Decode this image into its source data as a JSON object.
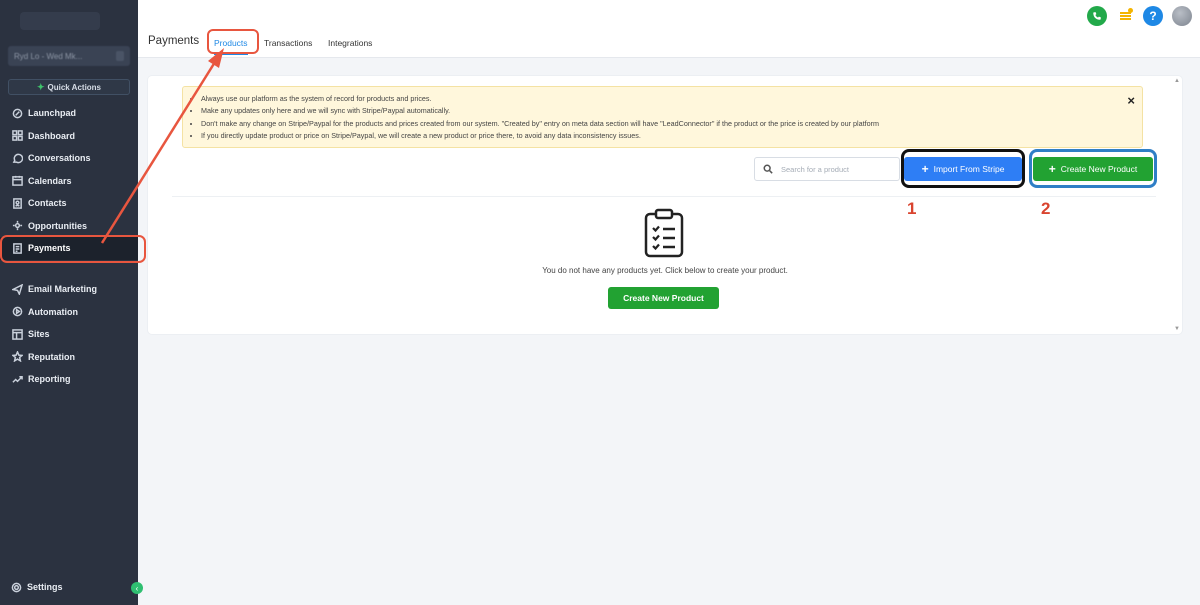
{
  "sidebar": {
    "location_text": "Ryd Lo - Wed Mk...",
    "quick_actions_label": "Quick Actions",
    "items": [
      {
        "label": "Launchpad",
        "icon": "rocket-icon"
      },
      {
        "label": "Dashboard",
        "icon": "dashboard-icon"
      },
      {
        "label": "Conversations",
        "icon": "chat-icon"
      },
      {
        "label": "Calendars",
        "icon": "calendar-icon"
      },
      {
        "label": "Contacts",
        "icon": "contacts-icon"
      },
      {
        "label": "Opportunities",
        "icon": "opportunities-icon"
      },
      {
        "label": "Payments",
        "icon": "payments-icon",
        "active": true
      }
    ],
    "items2": [
      {
        "label": "Email Marketing",
        "icon": "send-icon"
      },
      {
        "label": "Automation",
        "icon": "automation-icon"
      },
      {
        "label": "Sites",
        "icon": "sites-icon"
      },
      {
        "label": "Reputation",
        "icon": "star-icon"
      },
      {
        "label": "Reporting",
        "icon": "chart-icon"
      }
    ],
    "settings_label": "Settings"
  },
  "header": {
    "title": "Payments",
    "tabs": [
      {
        "label": "Products",
        "active": true
      },
      {
        "label": "Transactions"
      },
      {
        "label": "Integrations"
      }
    ]
  },
  "notice": {
    "lines": [
      "Always use our platform as the system of record for products and prices.",
      "Make any updates only here and we will sync with Stripe/Paypal automatically.",
      "Don't make any change on Stripe/Paypal for the products and prices created from our system. \"Created by\" entry on meta data section will have \"LeadConnector\" if the product or the price is created by our platform",
      "If you directly update product or price on Stripe/Paypal, we will create a new product or price there, to avoid any data inconsistency issues."
    ],
    "close_symbol": "×"
  },
  "toolbar": {
    "search_placeholder": "Search for a product",
    "import_label": "Import From Stripe",
    "create_label": "Create New Product"
  },
  "annotations": {
    "one": "1",
    "two": "2"
  },
  "empty_state": {
    "message": "You do not have any products yet. Click below to create your product.",
    "button_label": "Create New Product"
  },
  "colors": {
    "sidebar_bg": "#2b3240",
    "primary_blue": "#2e7ef5",
    "success_green": "#22a232",
    "highlight_red": "#e8563f",
    "notice_bg": "#fff7dc"
  }
}
